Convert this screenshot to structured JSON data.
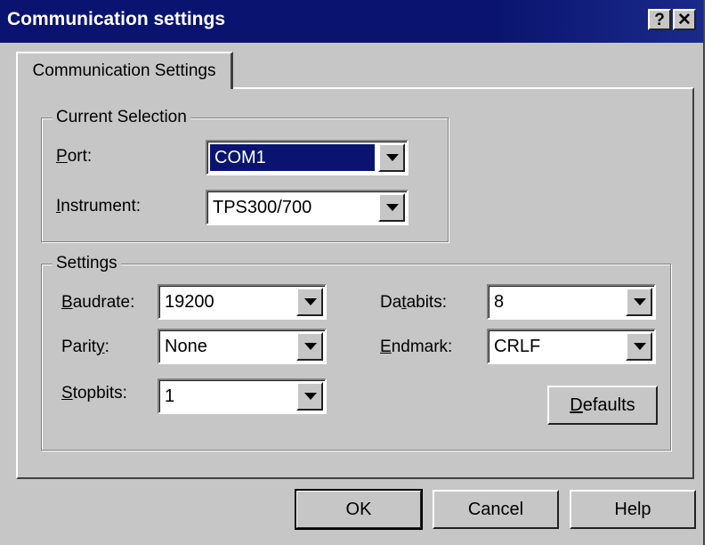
{
  "window": {
    "title": "Communication settings",
    "help_button": "?",
    "close_button": "✕"
  },
  "tabs": [
    {
      "label": "Communication Settings"
    }
  ],
  "current_selection": {
    "legend": "Current Selection",
    "port_label_ul": "P",
    "port_label_rest": "ort:",
    "port_value": "COM1",
    "instrument_label_ul": "I",
    "instrument_label_rest": "nstrument:",
    "instrument_value": "TPS300/700"
  },
  "settings": {
    "legend": "Settings",
    "baudrate_label_ul": "B",
    "baudrate_label_rest": "audrate:",
    "baudrate_value": "19200",
    "parity_label_pre": "Parit",
    "parity_label_ul": "y",
    "parity_label_rest": ":",
    "parity_value": "None",
    "stopbits_label_ul": "S",
    "stopbits_label_rest": "topbits:",
    "stopbits_value": "1",
    "databits_label_pre": "Da",
    "databits_label_ul": "t",
    "databits_label_rest": "abits:",
    "databits_value": "8",
    "endmark_label_ul": "E",
    "endmark_label_rest": "ndmark:",
    "endmark_value": "CRLF",
    "defaults_label_ul": "D",
    "defaults_label_rest": "efaults"
  },
  "footer": {
    "ok_label": "OK",
    "cancel_label": "Cancel",
    "help_label": "Help"
  }
}
